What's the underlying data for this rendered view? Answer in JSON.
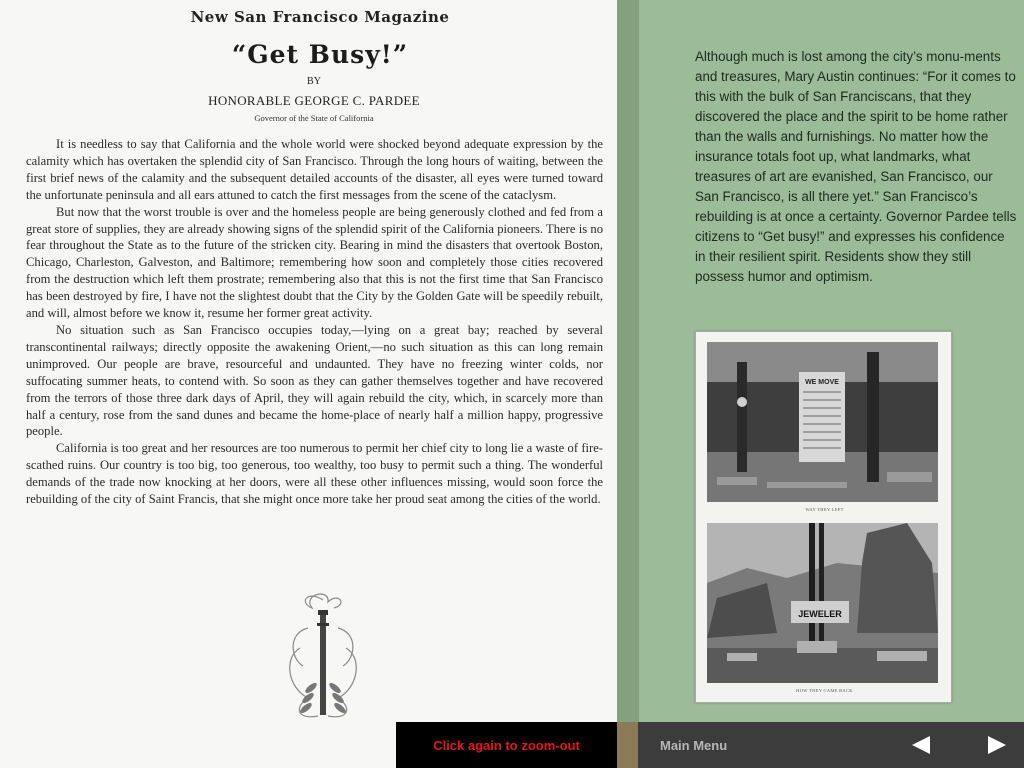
{
  "document": {
    "masthead": "New San Francisco Magazine",
    "title": "“Get Busy!”",
    "byline": "BY",
    "author": "HONORABLE GEORGE C. PARDEE",
    "author_role": "Governor of the State of California",
    "paragraphs": [
      "It is needless to say that California and the whole world were shocked beyond adequate expression by the calamity which has overtaken the splendid city of San Francisco. Through the long hours of waiting, between the first brief news of the calamity and the subsequent detailed accounts of the disaster, all eyes were turned toward the unfortunate peninsula and all ears attuned to catch the first messages from the scene of the cataclysm.",
      "But now that the worst trouble is over and the homeless people are being generously clothed and fed from a great store of supplies, they are already showing signs of the splendid spirit of the California pioneers. There is no fear throughout the State as to the future of the stricken city. Bearing in mind the disasters that overtook Boston, Chicago, Charleston, Galveston, and Baltimore; remembering how soon and completely those cities recovered from the destruction which left them prostrate; remembering also that this is not the first time that San Francisco has been destroyed by fire, I have not the slightest doubt that the City by the Golden Gate will be speedily rebuilt, and will, almost before we know it, resume her former great activity.",
      "No situation such as San Francisco occupies today,—lying on a great bay; reached by several transcontinental railways; directly opposite the awakening Orient,—no such situation as this can long remain unimproved. Our people are brave, resourceful and undaunted. They have no freezing winter colds, nor suffocating summer heats, to contend with. So soon as they can gather themselves together and have recovered from the terrors of those three dark days of April, they will again rebuild the city, which, in scarcely more than half a century, rose from the sand dunes and became the home-place of nearly half a million happy, progressive people.",
      "California is too great and her resources are too numerous to permit her chief city to long lie a waste of fire-scathed ruins. Our country is too big, too generous, too wealthy, too busy to permit such a thing. The wonderful demands of the trade now knocking at her doors, were all these other influences missing, would soon force the rebuilding of the city of Saint Francis, that she might once more take her proud seat among the cities of the world."
    ],
    "ornament_icon": "torch-icon"
  },
  "panel": {
    "caption": "Although much is lost among the city’s monu-ments and treasures, Mary Austin continues: “For it comes to this with the bulk of San Franciscans, that they discovered the place and the spirit to be home rather than the walls and furnishings. No matter how the insurance totals foot up, what landmarks, what treasures of art are evanished, San Francisco, our San Francisco, is all there yet.” San Francisco’s rebuilding is at once a certainty. Governor Pardee tells citizens to “Get busy!” and expresses his confidence in their resilient spirit. Residents show they still possess humor and optimism.",
    "photo_top_sign": "WE MOVE",
    "photo_bottom_sign": "JEWELER"
  },
  "toolbar": {
    "zoom_label": "Click again to zoom-out",
    "menu_label": "Main Menu",
    "prev_icon": "left-arrow-icon",
    "next_icon": "right-arrow-icon"
  },
  "colors": {
    "panel": "#9cbb98",
    "zoom_text": "#e8141b",
    "bar": "#3c3c3c"
  }
}
